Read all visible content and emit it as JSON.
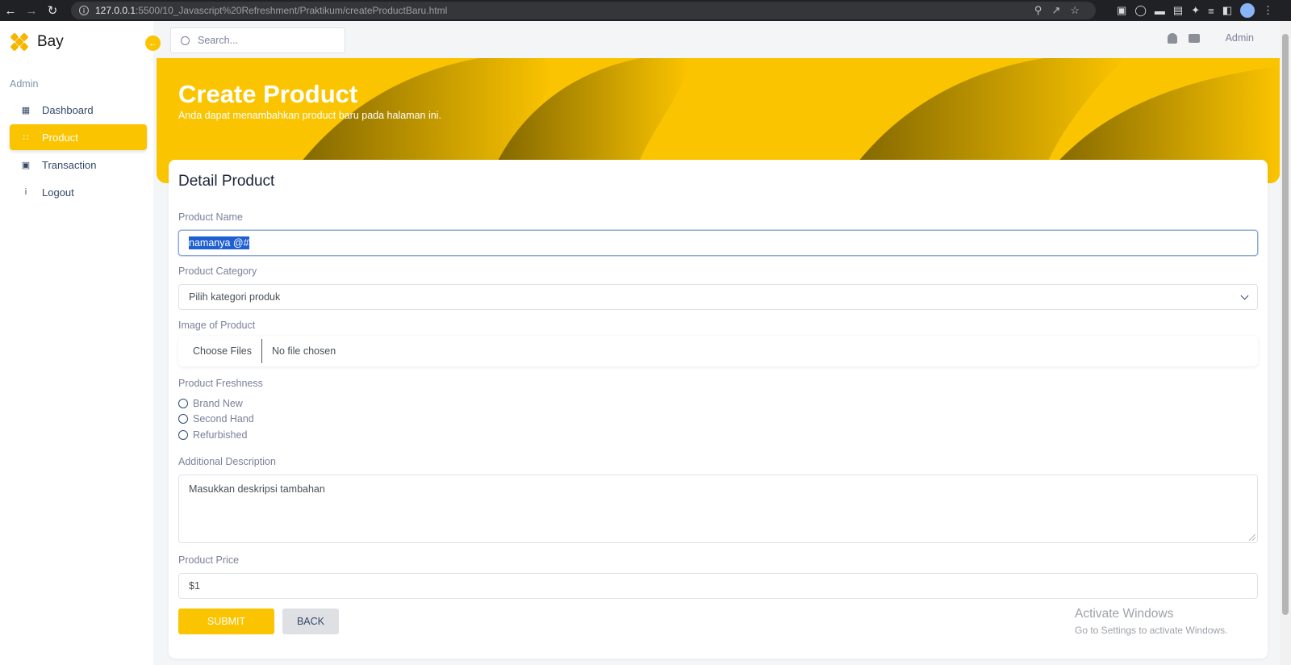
{
  "browser": {
    "url_host": "127.0.0.1",
    "url_rest": ":5500/10_Javascript%20Refreshment/Praktikum/createProductBaru.html"
  },
  "sidebar": {
    "brand": "Bay",
    "section": "Admin",
    "items": [
      {
        "label": "Dashboard",
        "icon": "dashboard-icon"
      },
      {
        "label": "Product",
        "icon": "product-icon",
        "active": true
      },
      {
        "label": "Transaction",
        "icon": "wallet-icon"
      },
      {
        "label": "Logout",
        "icon": "info-icon"
      }
    ]
  },
  "topbar": {
    "search_placeholder": "Search...",
    "user": "Admin"
  },
  "banner": {
    "title": "Create Product",
    "subtitle": "Anda dapat menambahkan product baru pada halaman ini."
  },
  "form": {
    "title": "Detail Product",
    "product_name_label": "Product Name",
    "product_name_value": "namanya @#",
    "category_label": "Product Category",
    "category_selected": "Pilih kategori produk",
    "image_label": "Image of Product",
    "choose_files": "Choose Files",
    "no_file": "No file chosen",
    "freshness_label": "Product Freshness",
    "freshness_options": [
      "Brand New",
      "Second Hand",
      "Refurbished"
    ],
    "description_label": "Additional Description",
    "description_placeholder": "Masukkan deskripsi tambahan",
    "price_label": "Product Price",
    "price_value": "$1",
    "submit": "SUBMIT",
    "back": "BACK"
  },
  "watermark": {
    "line1": "Activate Windows",
    "line2": "Go to Settings to activate Windows."
  },
  "colors": {
    "accent": "#fbc400",
    "banner_shadow": "#7d6300"
  }
}
